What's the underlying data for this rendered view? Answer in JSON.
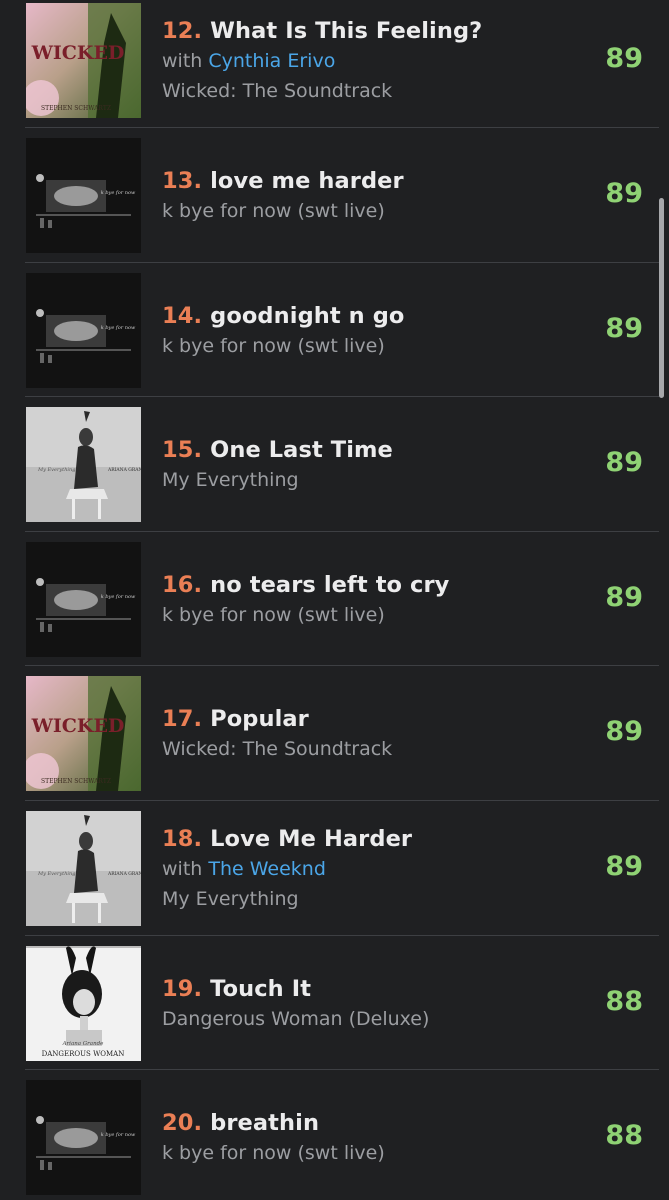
{
  "tracks": [
    {
      "rank": "12.",
      "title": "What Is This Feeling?",
      "with_prefix": "with",
      "featured": "Cynthia Erivo",
      "album": "Wicked: The Soundtrack",
      "score": "89",
      "cover": "wicked"
    },
    {
      "rank": "13.",
      "title": "love me harder",
      "with_prefix": "",
      "featured": "",
      "album": "k bye for now (swt live)",
      "score": "89",
      "cover": "kbye"
    },
    {
      "rank": "14.",
      "title": "goodnight n go",
      "with_prefix": "",
      "featured": "",
      "album": "k bye for now (swt live)",
      "score": "89",
      "cover": "kbye"
    },
    {
      "rank": "15.",
      "title": "One Last Time",
      "with_prefix": "",
      "featured": "",
      "album": "My Everything",
      "score": "89",
      "cover": "my-everything"
    },
    {
      "rank": "16.",
      "title": "no tears left to cry",
      "with_prefix": "",
      "featured": "",
      "album": "k bye for now (swt live)",
      "score": "89",
      "cover": "kbye"
    },
    {
      "rank": "17.",
      "title": "Popular",
      "with_prefix": "",
      "featured": "",
      "album": "Wicked: The Soundtrack",
      "score": "89",
      "cover": "wicked"
    },
    {
      "rank": "18.",
      "title": "Love Me Harder",
      "with_prefix": "with",
      "featured": "The Weeknd",
      "album": "My Everything",
      "score": "89",
      "cover": "my-everything"
    },
    {
      "rank": "19.",
      "title": "Touch It",
      "with_prefix": "",
      "featured": "",
      "album": "Dangerous Woman (Deluxe)",
      "score": "88",
      "cover": "dangerous-woman"
    },
    {
      "rank": "20.",
      "title": "breathin",
      "with_prefix": "",
      "featured": "",
      "album": "k bye for now (swt live)",
      "score": "88",
      "cover": "kbye"
    }
  ],
  "cover_text": {
    "wicked": "WICKED",
    "wicked_credit": "STEPHEN SCHWARTZ",
    "my_everything_title": "My Everything",
    "my_everything_artist": "ARIANA GRANDE",
    "dangerous_woman_artist": "Ariana Grande",
    "dangerous_woman_title": "DANGEROUS WOMAN",
    "kbye_text": "k bye for now"
  },
  "colors": {
    "background": "#1f2022",
    "rank": "#ea7f55",
    "title": "#ececed",
    "subtext": "#9c9ea2",
    "artist_link": "#4ba6e8",
    "score": "#8fd274",
    "divider": "#3d3f43"
  }
}
